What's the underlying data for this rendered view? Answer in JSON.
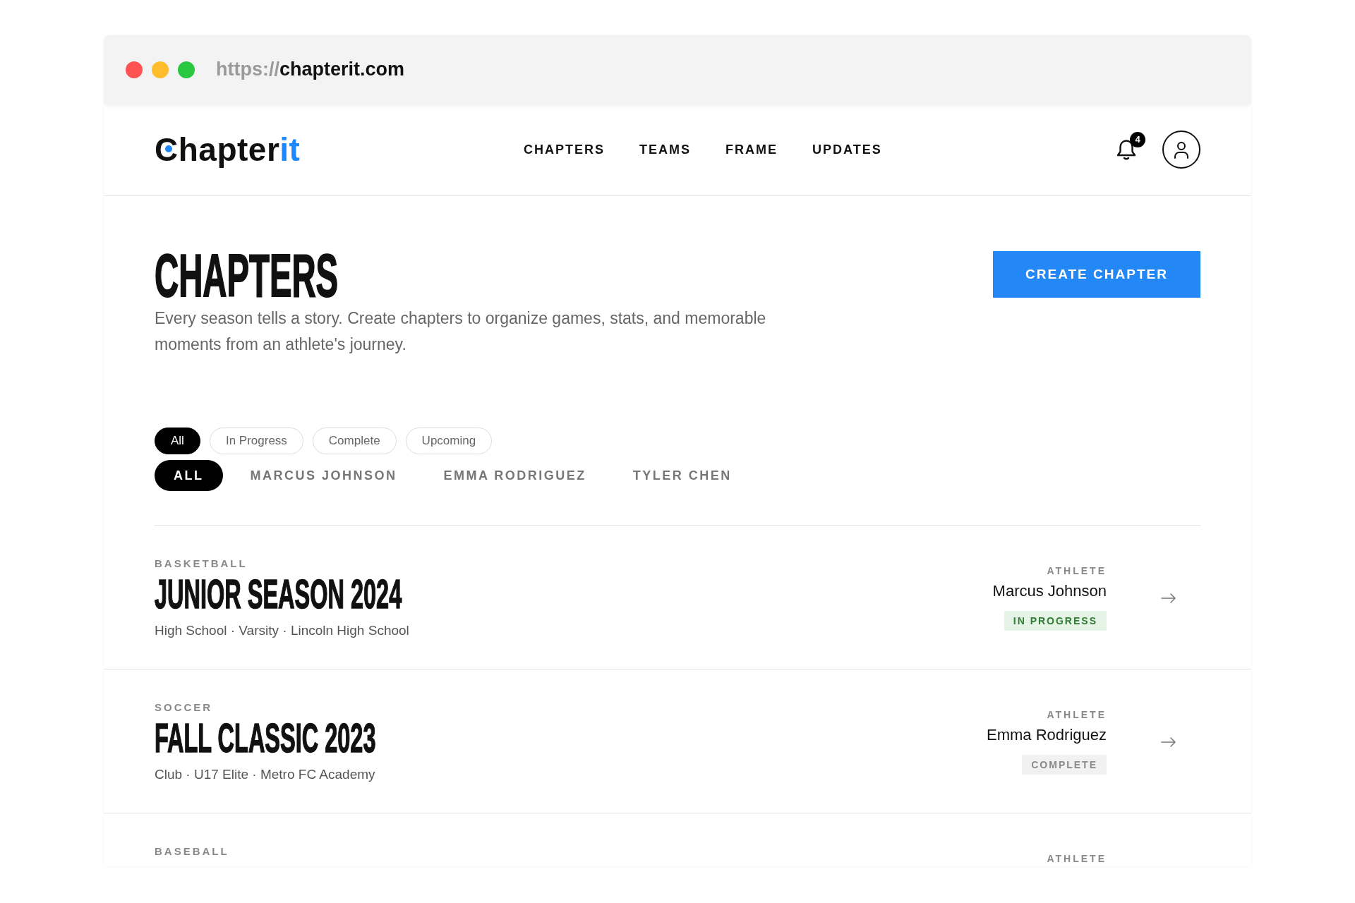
{
  "window_controls": [
    {
      "color": "#ff5252"
    },
    {
      "color": "#ffbd2e"
    },
    {
      "color": "#2ac840"
    }
  ],
  "address_bar": {
    "scheme": "https://",
    "host": "chapterit.com"
  },
  "header": {
    "logo": {
      "name": "Chapter",
      "accent": "it"
    },
    "nav": [
      {
        "label": "CHAPTERS"
      },
      {
        "label": "TEAMS"
      },
      {
        "label": "FRAME"
      },
      {
        "label": "UPDATES"
      }
    ],
    "notifications": {
      "count": "4"
    }
  },
  "page": {
    "title": "CHAPTERS",
    "description": "Every season tells a story. Create chapters to organize games, stats, and memorable moments from an athlete's journey.",
    "primary_action": "CREATE CHAPTER"
  },
  "status_filters": [
    {
      "label": "All",
      "selected": true
    },
    {
      "label": "In Progress",
      "selected": false
    },
    {
      "label": "Complete",
      "selected": false
    },
    {
      "label": "Upcoming",
      "selected": false
    }
  ],
  "athlete_filters": [
    {
      "label": "ALL",
      "selected": true
    },
    {
      "label": "MARCUS JOHNSON",
      "selected": false
    },
    {
      "label": "EMMA RODRIGUEZ",
      "selected": false
    },
    {
      "label": "TYLER CHEN",
      "selected": false
    }
  ],
  "chapters": [
    {
      "sport": "BASKETBALL",
      "title": "JUNIOR SEASON 2024",
      "details": "High School · Varsity · Lincoln High School",
      "athlete_label": "ATHLETE",
      "athlete": "Marcus Johnson",
      "status": {
        "label": "IN PROGRESS",
        "kind": "in_progress"
      }
    },
    {
      "sport": "SOCCER",
      "title": "FALL CLASSIC 2023",
      "details": "Club · U17 Elite · Metro FC Academy",
      "athlete_label": "ATHLETE",
      "athlete": "Emma Rodriguez",
      "status": {
        "label": "COMPLETE",
        "kind": "complete"
      }
    },
    {
      "sport": "BASEBALL",
      "athlete_label": "ATHLETE"
    }
  ]
}
